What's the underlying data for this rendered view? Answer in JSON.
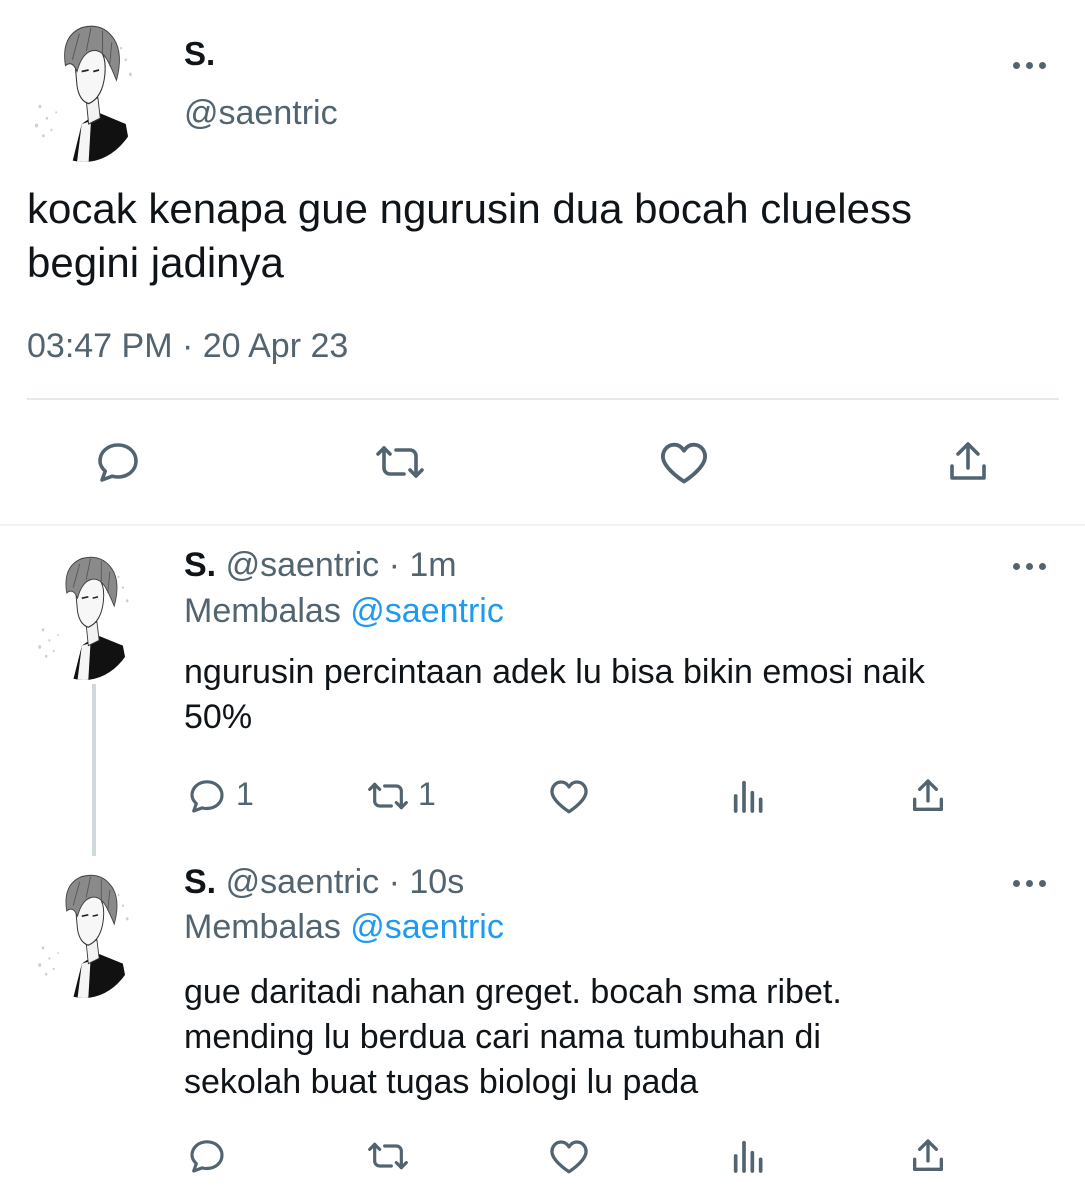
{
  "main_tweet": {
    "display_name": "S.",
    "handle": "@saentric",
    "text_lines": [
      "kocak kenapa gue ngurusin dua bocah clueless",
      "begini jadinya"
    ],
    "timestamp": "03:47 PM · 20 Apr 23",
    "actions": [
      "reply-icon",
      "retweet-icon",
      "like-icon",
      "share-icon"
    ]
  },
  "replies": [
    {
      "display_name": "S.",
      "handle": "@saentric",
      "sep": "·",
      "time": "1m",
      "replying_label": "Membalas",
      "replying_to": "@saentric",
      "text_lines": [
        "ngurusin percintaan adek lu bisa bikin emosi naik",
        "50%"
      ],
      "reply_count": "1",
      "retweet_count": "1"
    },
    {
      "display_name": "S.",
      "handle": "@saentric",
      "sep": "·",
      "time": "10s",
      "replying_label": "Membalas",
      "replying_to": "@saentric",
      "text_lines": [
        "gue daritadi nahan greget. bocah sma ribet.",
        "mending lu berdua cari nama tumbuhan di",
        "sekolah buat tugas biologi lu pada"
      ],
      "reply_count": "",
      "retweet_count": ""
    }
  ],
  "colors": {
    "text": "#0f1419",
    "muted": "#536471",
    "link": "#1d9bf0",
    "divider": "#cfd9de"
  }
}
